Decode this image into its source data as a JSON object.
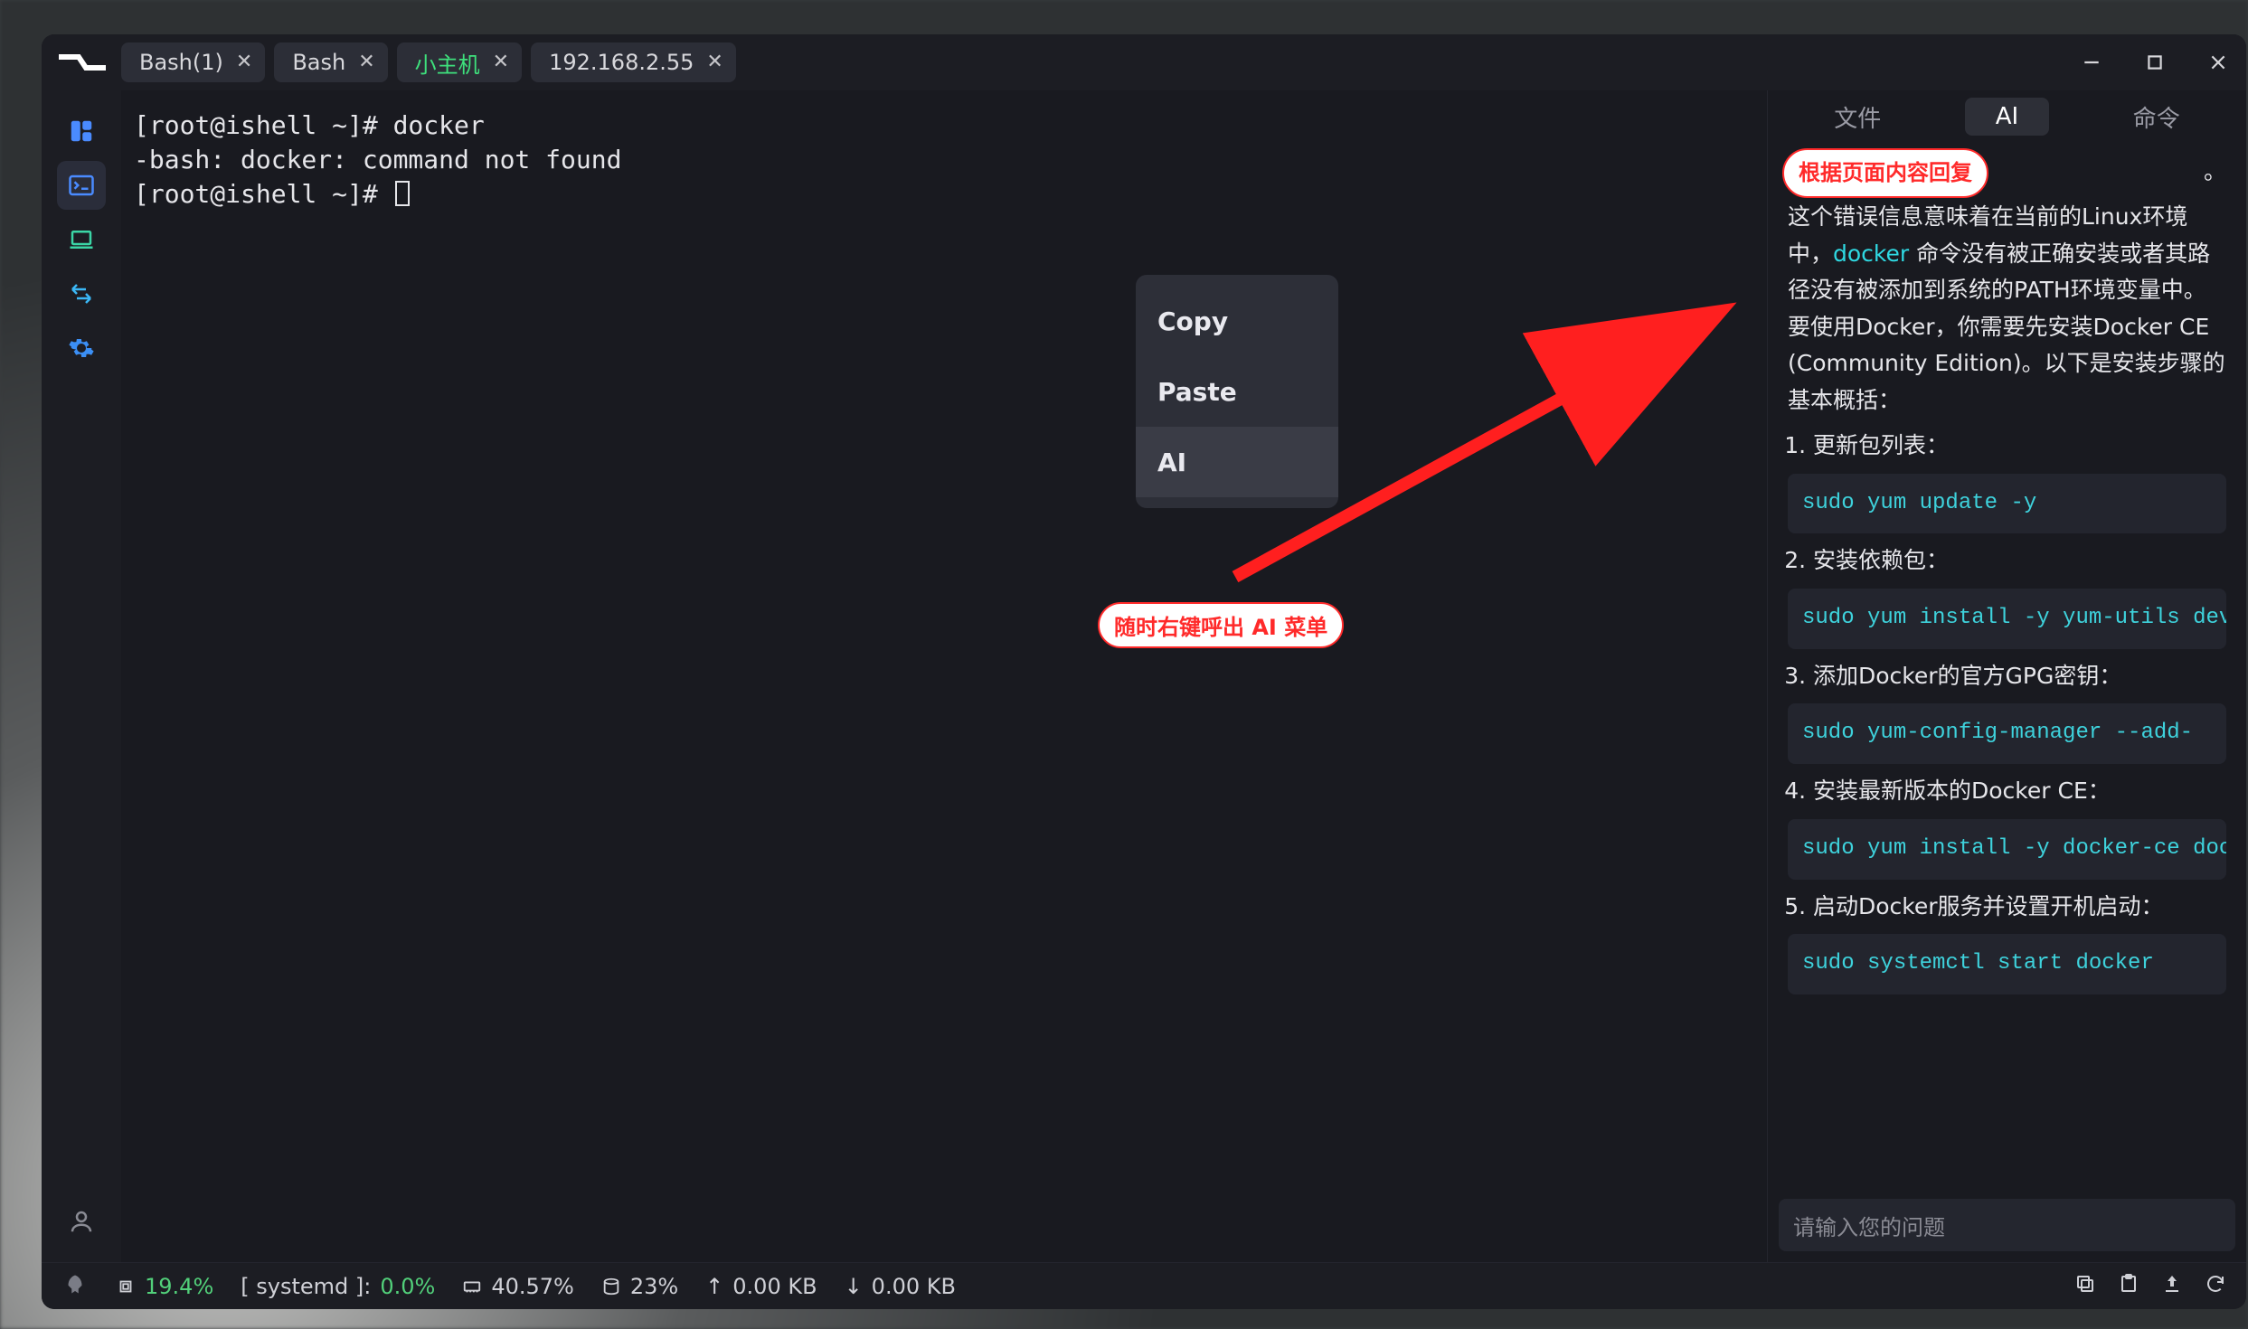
{
  "tabs": [
    {
      "label": "Bash(1)"
    },
    {
      "label": "Bash"
    },
    {
      "label": "小主机",
      "active": true
    },
    {
      "label": "192.168.2.55"
    }
  ],
  "terminal": {
    "line1": "[root@ishell ~]# docker",
    "line2": "-bash: docker: command not found",
    "line3": "[root@ishell ~]# "
  },
  "context_menu": {
    "copy": "Copy",
    "paste": "Paste",
    "ai": "AI"
  },
  "annotations": {
    "context_pill": "随时右键呼出 AI 菜单",
    "panel_pill": "根据页面内容回复"
  },
  "right_panel": {
    "tabs": {
      "files": "文件",
      "ai": "AI",
      "cmd": "命令"
    },
    "top_fragment_suffix": "。",
    "paragraph_prefix": "这个错误信息意味着在当前的Linux环境中，",
    "docker_kw": "docker",
    "paragraph_suffix": " 命令没有被正确安装或者其路径没有被添加到系统的PATH环境变量中。要使用Docker，你需要先安装Docker CE (Community Edition)。以下是安装步骤的基本概括：",
    "steps": [
      {
        "label": "更新包列表：",
        "code": "sudo yum update -y"
      },
      {
        "label": "安装依赖包：",
        "code": "sudo yum install -y yum-utils devi"
      },
      {
        "label": "添加Docker的官方GPG密钥：",
        "code": "sudo yum-config-manager --add-"
      },
      {
        "label": "安装最新版本的Docker CE：",
        "code": "sudo yum install -y docker-ce doc"
      },
      {
        "label": "启动Docker服务并设置开机启动：",
        "code": "sudo systemctl start docker"
      }
    ],
    "input_placeholder": "请输入您的问题"
  },
  "statusbar": {
    "cpu": "19.4%",
    "proc_label": "[ systemd ]:",
    "proc_value": "0.0%",
    "mem": "40.57%",
    "disk": "23%",
    "up": "0.00 KB",
    "down": "0.00 KB"
  }
}
